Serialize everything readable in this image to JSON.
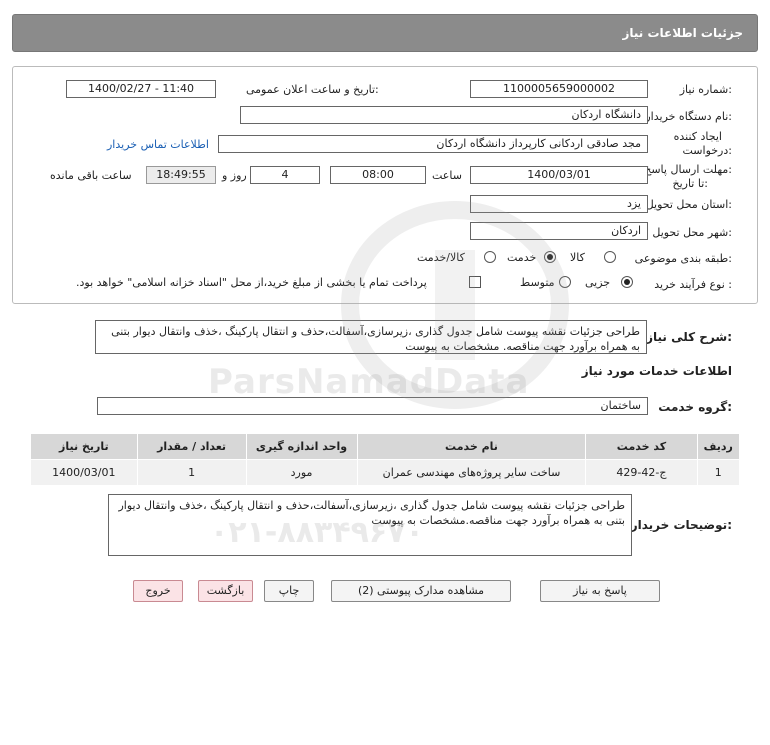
{
  "header": {
    "title": "جزئیات اطلاعات نیاز"
  },
  "form": {
    "need_number_label": "شماره نیاز:",
    "need_number": "1100005659000002",
    "announce_label": "تاریخ و ساعت اعلان عمومی:",
    "announce_value": "1400/02/27 - 11:40",
    "buyer_org_label": "نام دستگاه خریدار:",
    "buyer_org": "دانشگاه اردکان",
    "creator_label_1": "ایجاد کننده",
    "creator_label_2": "درخواست:",
    "creator": "مجد صادقی اردکانی کارپرداز دانشگاه اردکان",
    "contact_link": "اطلاعات تماس خریدار",
    "deadline_label_1": "مهلت ارسال پاسخ:",
    "deadline_label_2": "تا تاریخ:",
    "deadline_date": "1400/03/01",
    "time_label": "ساعت",
    "deadline_time": "08:00",
    "days_value": "4",
    "days_label": "روز و",
    "remaining_time": "18:49:55",
    "remaining_label": "ساعت باقی مانده",
    "province_label": "استان محل تحویل:",
    "province": "یزد",
    "city_label": "شهر محل تحویل:",
    "city": "اردکان",
    "category_label": "طبقه بندی موضوعی:",
    "category_options": [
      "کالا",
      "خدمت",
      "کالا/خدمت"
    ],
    "process_label": "نوع فرآیند خرید :",
    "process_options": [
      "جزیی",
      "متوسط"
    ],
    "payment_note": "پرداخت تمام یا بخشی از مبلغ خرید،از محل \"اسناد خزانه اسلامی\" خواهد بود."
  },
  "summary": {
    "label": "شرح کلی نیاز:",
    "text": "طراحی جزئیات نقشه پیوست شامل جدول گذاری ،زیرسازی،آسفالت،حذف و انتقال پارکینگ ،خذف وانتقال دیوار بتنی به همراه برآورد جهت مناقصه. مشخصات به پیوست"
  },
  "services": {
    "title": "اطلاعات خدمات مورد نیاز",
    "group_label": "گروه خدمت:",
    "group_value": "ساختمان",
    "columns": [
      "ردیف",
      "کد خدمت",
      "نام خدمت",
      "واحد اندازه گیری",
      "تعداد / مقدار",
      "تاریخ نیاز"
    ],
    "rows": [
      [
        "1",
        "ج-42-429",
        "ساخت سایر پروژه‌های مهندسی عمران",
        "مورد",
        "1",
        "1400/03/01"
      ]
    ]
  },
  "buyer_notes": {
    "label": "توضیحات خریدار:",
    "text": "طراحی جزئیات نقشه پیوست شامل جدول گذاری ،زیرسازی،آسفالت،حذف و انتقال پارکینگ ،خذف وانتقال دیوار بتنی به همراه برآورد جهت مناقصه.مشخصات به پیوست"
  },
  "buttons": {
    "reply": "پاسخ به نیاز",
    "attachments": "مشاهده مدارک پیوستی (2)",
    "print": "چاپ",
    "back": "بازگشت",
    "exit": "خروج"
  },
  "watermark": {
    "brand": "ParsNamadData",
    "phone": "۰۲۱-۸۸۳۴۹۶۷۰"
  }
}
